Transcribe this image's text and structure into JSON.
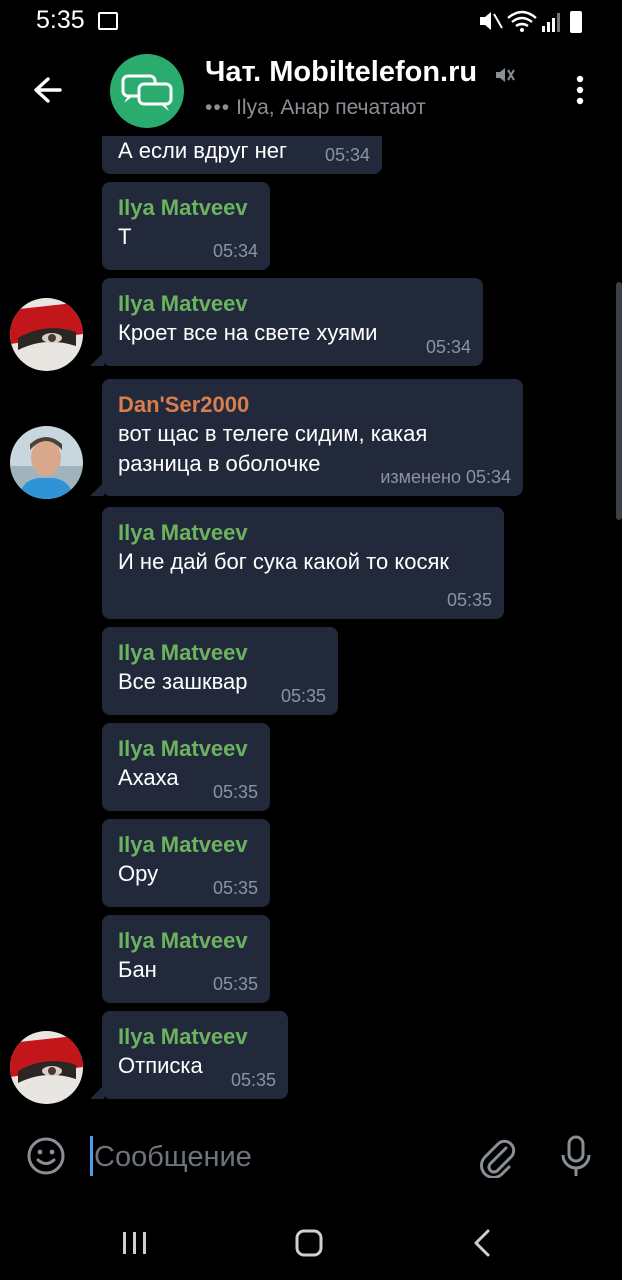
{
  "status_bar": {
    "time": "5:35"
  },
  "header": {
    "title": "Чат. Mobiltelefon.ru",
    "typing_indicator": "•••",
    "subtitle": "Ilya, Анар печатают"
  },
  "messages": [
    {
      "sender": "",
      "text": "А если вдруг нег",
      "time": "05:34"
    },
    {
      "sender": "Ilya Matveev",
      "text": "Т",
      "time": "05:34"
    },
    {
      "sender": "Ilya Matveev",
      "text": "Кроет все на свете хуями",
      "time": "05:34"
    },
    {
      "sender": "Dan'Ser2000",
      "text": "вот щас в телеге сидим, какая разница в оболочке",
      "time": "изменено 05:34"
    },
    {
      "sender": "Ilya Matveev",
      "text": "И не дай бог сука какой то косяк",
      "time": "05:35"
    },
    {
      "sender": "Ilya Matveev",
      "text": "Все зашквар",
      "time": "05:35"
    },
    {
      "sender": "Ilya Matveev",
      "text": "Ахаха",
      "time": "05:35"
    },
    {
      "sender": "Ilya Matveev",
      "text": "Ору",
      "time": "05:35"
    },
    {
      "sender": "Ilya Matveev",
      "text": "Бан",
      "time": "05:35"
    },
    {
      "sender": "Ilya Matveev",
      "text": "Отписка",
      "time": "05:35"
    }
  ],
  "composer": {
    "placeholder": "Сообщение"
  },
  "colors": {
    "accent": "#2bac6f",
    "sender_green": "#6bb35f",
    "sender_orange": "#d97e4c",
    "bubble": "#22293a"
  },
  "icons": [
    "back-arrow-icon",
    "mute-icon",
    "more-vert-icon",
    "emoji-icon",
    "paperclip-icon",
    "microphone-icon"
  ]
}
